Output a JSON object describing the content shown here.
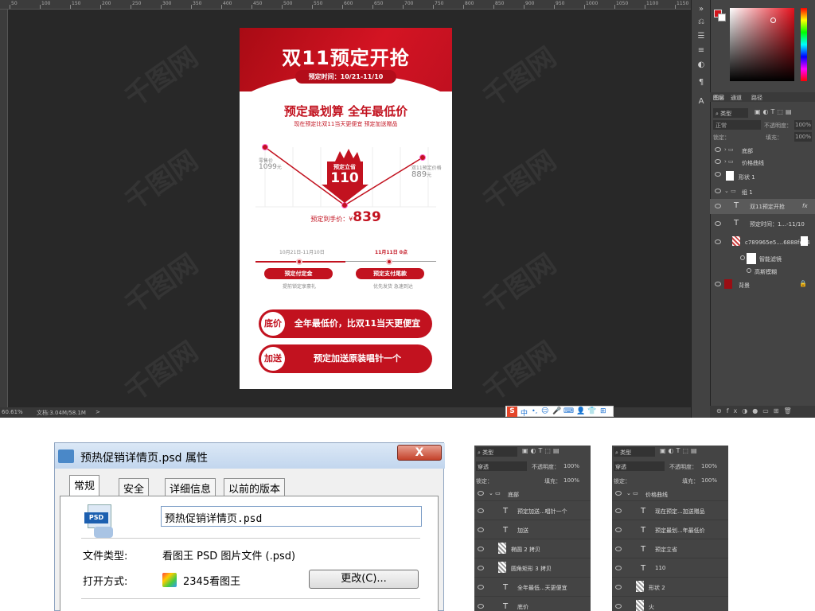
{
  "ps": {
    "ruler_ticks": [
      "50",
      "100",
      "150",
      "200",
      "250",
      "300",
      "350",
      "400",
      "450",
      "500",
      "550",
      "600",
      "650",
      "700",
      "750",
      "800",
      "850",
      "900",
      "950",
      "1000",
      "1050",
      "1100",
      "1150"
    ],
    "status_zoom": "60.61%",
    "status_doc": "文档:3.04M/58.1M",
    "status_arrow": ">",
    "panel_tabs": [
      "图层",
      "通道",
      "路径"
    ],
    "layer_filter": "类型",
    "blend_mode": "正常",
    "opacity_label": "不透明度：",
    "opacity_value": "100%",
    "lock_label": "锁定：",
    "fill_label": "填充：",
    "fill_value": "100%",
    "layers": [
      {
        "name": "底部",
        "type": "folder"
      },
      {
        "name": "价格曲线",
        "type": "folder"
      },
      {
        "name": "形状 1",
        "type": "shape"
      },
      {
        "name": "组 1",
        "type": "folder-open"
      },
      {
        "name": "双11预定开抢",
        "type": "text",
        "fx": "fx"
      },
      {
        "name": "预定时间：1...-11/10",
        "type": "text"
      },
      {
        "name": "c789965e5....6888fea4",
        "type": "smart"
      },
      {
        "name": "智能滤镜",
        "type": "filter"
      },
      {
        "name": "高斯模糊",
        "type": "filter-item"
      },
      {
        "name": "背景",
        "type": "bg"
      }
    ],
    "accent": "#d1151c"
  },
  "poster": {
    "title": "双11预定开抢",
    "date": "预定时间：10/21-11/10",
    "headline": "预定最划算  全年最低价",
    "subline": "现在预定比双11当天更便宜 预定加送赠品",
    "left_price_label": "零售价",
    "left_price": "1099",
    "left_price_unit": "元",
    "right_price_label": "双11预定价格",
    "right_price": "889",
    "right_price_unit": "元",
    "badge_top": "预定立省",
    "badge_value": "110",
    "final_label": "预定到手价：¥",
    "final_price": "839",
    "step1_date": "10月21日-11月10日",
    "step2_date": "11月11日 0点",
    "step1_pill": "预定付定金",
    "step2_pill": "预定支付尾款",
    "step1_desc": "提前锁定享豪礼",
    "step2_desc": "优先发货 急速到达",
    "btn1_circle": "底价",
    "btn1_text": "全年最低价，比双11当天更便宜",
    "btn2_circle": "加送",
    "btn2_text": "预定加送原装唱针一个",
    "red": "#c2121f"
  },
  "taskbar_icons": [
    "S",
    "中",
    "•,",
    "☺",
    "🎤",
    "⌨",
    "👤",
    "👕",
    "⊞"
  ],
  "dialog": {
    "title": "预热促销详情页.psd 属性",
    "close": "X",
    "tabs": [
      "常规",
      "安全",
      "详细信息",
      "以前的版本"
    ],
    "file_icon_text": "PSD",
    "filename": "预热促销详情页.psd",
    "type_label": "文件类型:",
    "type_value": "看图王 PSD 图片文件 (.psd)",
    "open_label": "打开方式:",
    "open_value": "2345看图王",
    "change_button": "更改(C)..."
  },
  "mini_panel_left": {
    "filter": "类型",
    "mode": "穿透",
    "opacity_label": "不透明度：",
    "opacity": "100%",
    "lock": "锁定：",
    "fill_label": "填充：",
    "fill": "100%",
    "group": "底部",
    "rows": [
      {
        "icon": "T",
        "name": "预定加送...唱针一个"
      },
      {
        "icon": "T",
        "name": "加送"
      },
      {
        "icon": "img",
        "name": "椭圆 2 拷贝"
      },
      {
        "icon": "img",
        "name": "圆角矩形 3 拷贝"
      },
      {
        "icon": "T",
        "name": "全年最低...天更便宜"
      },
      {
        "icon": "T",
        "name": "底价"
      }
    ]
  },
  "mini_panel_right": {
    "filter": "类型",
    "mode": "穿透",
    "opacity_label": "不透明度：",
    "opacity": "100%",
    "lock": "锁定：",
    "fill_label": "填充：",
    "fill": "100%",
    "group": "价格曲线",
    "rows": [
      {
        "icon": "T",
        "name": "现在预定...加送赠品"
      },
      {
        "icon": "T",
        "name": "预定最划...年最低价"
      },
      {
        "icon": "T",
        "name": "预定立省"
      },
      {
        "icon": "T",
        "name": "110"
      },
      {
        "icon": "img",
        "name": "形状 2"
      },
      {
        "icon": "img",
        "name": "火"
      }
    ]
  }
}
